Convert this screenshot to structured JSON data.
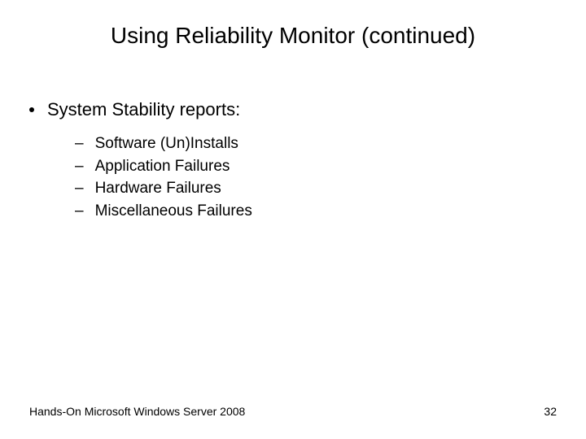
{
  "title": "Using Reliability Monitor (continued)",
  "bullet": {
    "text": "System Stability reports:",
    "subitems": [
      "Software (Un)Installs",
      "Application Failures",
      "Hardware Failures",
      "Miscellaneous Failures"
    ]
  },
  "footer": {
    "left": "Hands-On Microsoft Windows Server 2008",
    "right": "32"
  }
}
